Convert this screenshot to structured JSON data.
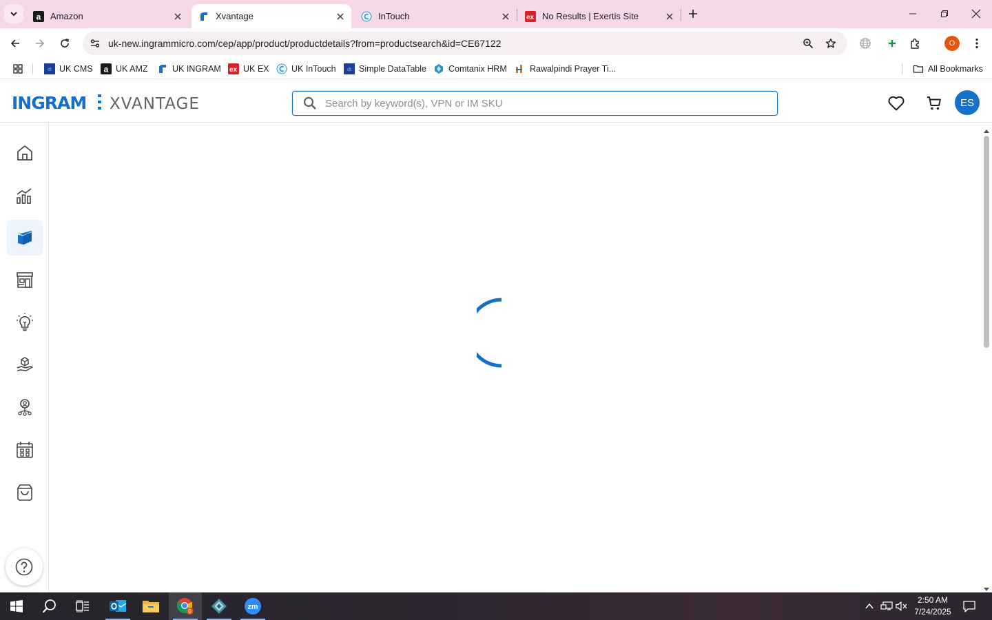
{
  "browser": {
    "tabs": [
      {
        "title": "Amazon",
        "favicon": "amazon-icon",
        "active": false
      },
      {
        "title": "Xvantage",
        "favicon": "ingram-icon",
        "active": true
      },
      {
        "title": "InTouch",
        "favicon": "intouch-icon",
        "active": false
      },
      {
        "title": "No Results | Exertis Site",
        "favicon": "exertis-icon",
        "active": false
      }
    ],
    "url": "uk-new.ingrammicro.com/cep/app/product/productdetails?from=productsearch&id=CE67122",
    "profile_initial": "O",
    "bookmarks": [
      {
        "label": "UK CMS",
        "icon": "dt-icon"
      },
      {
        "label": "UK AMZ",
        "icon": "amazon-icon"
      },
      {
        "label": "UK INGRAM",
        "icon": "ingram-icon"
      },
      {
        "label": "UK EX",
        "icon": "exertis-icon"
      },
      {
        "label": "UK InTouch",
        "icon": "intouch-icon"
      },
      {
        "label": "Simple DataTable",
        "icon": "dt-icon"
      },
      {
        "label": "Comtanix HRM",
        "icon": "comtanix-icon"
      },
      {
        "label": "Rawalpindi Prayer Ti...",
        "icon": "prayer-icon"
      }
    ],
    "all_bookmarks": "All Bookmarks"
  },
  "app": {
    "logo_brand": "INGRAM",
    "logo_product": "XVANTAGE",
    "search_placeholder": "Search by keyword(s), VPN or IM SKU",
    "avatar_initials": "ES",
    "sidebar": [
      {
        "name": "home",
        "icon": "home-icon",
        "active": false
      },
      {
        "name": "analytics",
        "icon": "bar-chart-icon",
        "active": false
      },
      {
        "name": "products",
        "icon": "box-icon",
        "active": true
      },
      {
        "name": "store",
        "icon": "storefront-icon",
        "active": false
      },
      {
        "name": "ideas",
        "icon": "lightbulb-icon",
        "active": false
      },
      {
        "name": "services",
        "icon": "hand-box-icon",
        "active": false
      },
      {
        "name": "support",
        "icon": "person-network-icon",
        "active": false
      },
      {
        "name": "calendar",
        "icon": "calendar-icon",
        "active": false
      },
      {
        "name": "orders",
        "icon": "shopping-bag-icon",
        "active": false
      }
    ],
    "loading": true
  },
  "taskbar": {
    "time": "2:50 AM",
    "date": "7/24/2025",
    "chrome_badge": "0"
  },
  "colors": {
    "brand_blue": "#1570c9",
    "tabstrip_bg": "#f5d9e8",
    "profile_orange": "#e8530e"
  }
}
